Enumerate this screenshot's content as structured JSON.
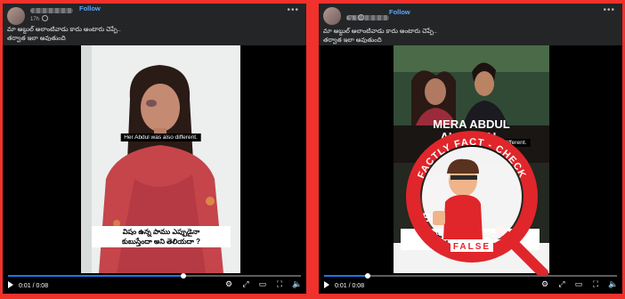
{
  "posts": [
    {
      "follow_label": "Follow",
      "time": "17h",
      "caption_line1": "మా అబ్దుల్ అలాంటివాడు కాదు అంటారు చెప్పే..",
      "caption_line2": "తర్వాత ఇలా అవుతుంది",
      "video": {
        "subtitle": "Her Abdul was also different.",
        "telugu_line1": "విషం ఉన్న పాము ఎప్పుడైనా",
        "telugu_line2": "కుబుస్తేందా అని తెలియదా ?",
        "time": "0:01 / 0:08",
        "progress": 0.6
      }
    },
    {
      "follow_label": "Follow",
      "time": "17h",
      "caption_line1": "మా అబ్దుల్ అలాంటివాడు కాదు అంటారు చెప్పే..",
      "caption_line2": "తర్వాత ఇలా అవుతుంది",
      "video": {
        "overlay_line1": "MERA ABDUL",
        "overlay_line2": "ALAG HAI..",
        "subtitle": "Her Abdul was also different.",
        "overlay_bottom": "ABDUL",
        "telugu_line1": "విషం ఉన్న పాము ఎప్పుడైనా",
        "telugu_line2": "కుబుస్తేందా అని తెలియదా ?",
        "time": "0:01 / 0:08",
        "progress": 0.15
      }
    }
  ],
  "stamp": {
    "ring_text": "FACTLY FACT - CHECK",
    "verdict": "FALSE"
  },
  "colors": {
    "frame": "#f0312c",
    "link": "#5aa7ff",
    "progress": "#1877f2",
    "stamp": "#e0262b"
  }
}
